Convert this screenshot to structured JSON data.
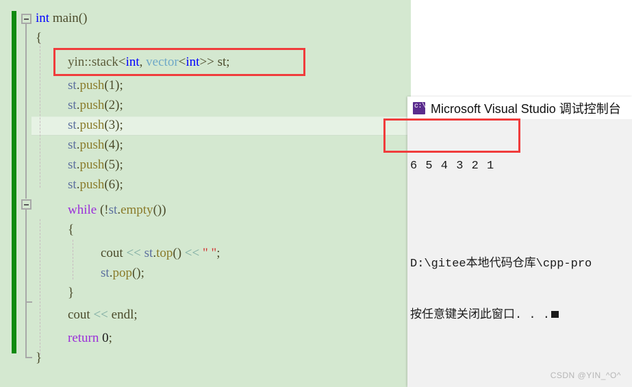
{
  "editor": {
    "background_color": "#d4e8d0",
    "change_bar_color": "#108a10",
    "current_line": "st.push(3);",
    "lines": [
      {
        "indent": 0,
        "text": "int main()"
      },
      {
        "indent": 1,
        "text": "{"
      },
      {
        "indent": 2,
        "text": "yin::stack<int, vector<int>> st;"
      },
      {
        "indent": 2,
        "text": "st.push(1);"
      },
      {
        "indent": 2,
        "text": "st.push(2);"
      },
      {
        "indent": 2,
        "text": "st.push(3);"
      },
      {
        "indent": 2,
        "text": "st.push(4);"
      },
      {
        "indent": 2,
        "text": "st.push(5);"
      },
      {
        "indent": 2,
        "text": "st.push(6);"
      },
      {
        "indent": 2,
        "text": "while (!st.empty())"
      },
      {
        "indent": 2,
        "text": "{"
      },
      {
        "indent": 3,
        "text": "cout << st.top() << \" \";"
      },
      {
        "indent": 3,
        "text": "st.pop();"
      },
      {
        "indent": 2,
        "text": "}"
      },
      {
        "indent": 2,
        "text": "cout << endl;"
      },
      {
        "indent": 2,
        "text": "return 0;"
      },
      {
        "indent": 1,
        "text": "}"
      }
    ],
    "tokens": {
      "t_int": "int",
      "t_main": " main()",
      "t_open_brace": "{",
      "t_close_brace": "}",
      "t_yin_stack": "yin::stack",
      "t_lt": "<",
      "t_comma": ", ",
      "t_vector": "vector",
      "t_gtgt": ">>",
      "t_gt": ">",
      "t_st_decl": " st;",
      "t_st": "st",
      "t_dot": ".",
      "t_push": "push",
      "t_paren1": "(1);",
      "t_paren2": "(2);",
      "t_paren3": "(3);",
      "t_paren4": "(4);",
      "t_paren5": "(5);",
      "t_paren6": "(6);",
      "t_while": "while",
      "t_while_cond_open": " (!",
      "t_empty": "empty",
      "t_empty_close": "())",
      "t_cout": "cout ",
      "t_shift": "<<",
      "t_top": "top",
      "t_top_close": "() ",
      "t_string_space": "\" \"",
      "t_semi": ";",
      "t_pop": "pop",
      "t_pop_close": "();",
      "t_endl": " endl;",
      "t_return": "return",
      "t_zero": " 0",
      "t_space": " "
    },
    "colors": {
      "keyword": "#0000ff",
      "control": "#9b30d9",
      "identifier": "#5c6f9e",
      "member": "#8a7b2a",
      "template": "#6fa8c7",
      "operator": "#7aa9a0",
      "string": "#d13030",
      "plain": "#4b4b2b"
    }
  },
  "console": {
    "title": "Microsoft Visual Studio 调试控制台",
    "icon": "console-window-icon",
    "output": "6 5 4 3 2 1",
    "path_line": "D:\\gitee本地代码仓库\\cpp-pro",
    "prompt_line": "按任意键关闭此窗口. . .",
    "cursor": "block-cursor"
  },
  "annotations": {
    "highlight_color": "#f03c3c",
    "code_box_label": "stack-declaration-highlight",
    "console_box_label": "console-output-highlight"
  },
  "watermark": {
    "text": "CSDN @YIN_^O^"
  }
}
